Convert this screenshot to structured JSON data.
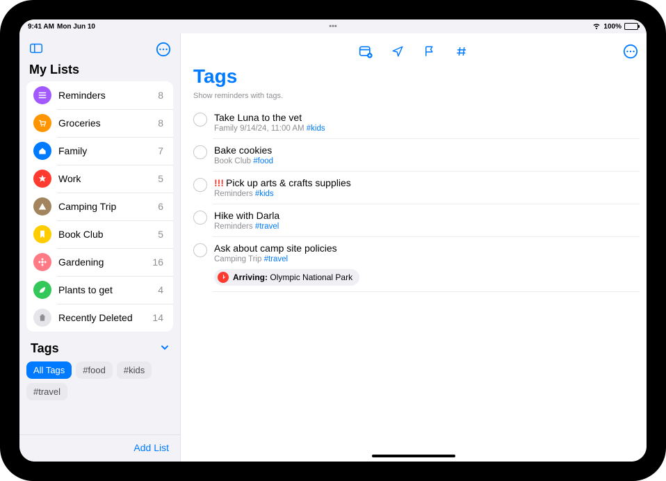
{
  "status": {
    "time": "9:41 AM",
    "date": "Mon Jun 10",
    "battery_pct": "100%"
  },
  "sidebar": {
    "my_lists_title": "My Lists",
    "lists": [
      {
        "name": "Reminders",
        "count": "8",
        "color": "#a259ff",
        "icon": "reminders"
      },
      {
        "name": "Groceries",
        "count": "8",
        "color": "#ff9500",
        "icon": "cart"
      },
      {
        "name": "Family",
        "count": "7",
        "color": "#007aff",
        "icon": "house"
      },
      {
        "name": "Work",
        "count": "5",
        "color": "#ff3b30",
        "icon": "star"
      },
      {
        "name": "Camping Trip",
        "count": "6",
        "color": "#a2845e",
        "icon": "tent"
      },
      {
        "name": "Book Club",
        "count": "5",
        "color": "#ffcc00",
        "icon": "bookmark"
      },
      {
        "name": "Gardening",
        "count": "16",
        "color": "#ff7a85",
        "icon": "flower"
      },
      {
        "name": "Plants to get",
        "count": "4",
        "color": "#34c759",
        "icon": "leaf"
      },
      {
        "name": "Recently Deleted",
        "count": "14",
        "color": "#c7c7cc",
        "icon": "trash"
      }
    ],
    "tags_title": "Tags",
    "tags": [
      {
        "label": "All Tags",
        "active": true
      },
      {
        "label": "#food",
        "active": false
      },
      {
        "label": "#kids",
        "active": false
      },
      {
        "label": "#travel",
        "active": false
      }
    ],
    "add_list_label": "Add List"
  },
  "main": {
    "title": "Tags",
    "subtitle": "Show reminders with tags.",
    "reminders": [
      {
        "title": "Take Luna to the vet",
        "meta_list": "Family",
        "meta_extra": "9/14/24, 11:00 AM",
        "tag": "#kids",
        "priority": ""
      },
      {
        "title": "Bake cookies",
        "meta_list": "Book Club",
        "meta_extra": "",
        "tag": "#food",
        "priority": ""
      },
      {
        "title": "Pick up arts & crafts supplies",
        "meta_list": "Reminders",
        "meta_extra": "",
        "tag": "#kids",
        "priority": "!!!"
      },
      {
        "title": "Hike with Darla",
        "meta_list": "Reminders",
        "meta_extra": "",
        "tag": "#travel",
        "priority": ""
      },
      {
        "title": "Ask about camp site policies",
        "meta_list": "Camping Trip",
        "meta_extra": "",
        "tag": "#travel",
        "priority": "",
        "location_label": "Arriving:",
        "location_value": "Olympic National Park"
      }
    ]
  }
}
